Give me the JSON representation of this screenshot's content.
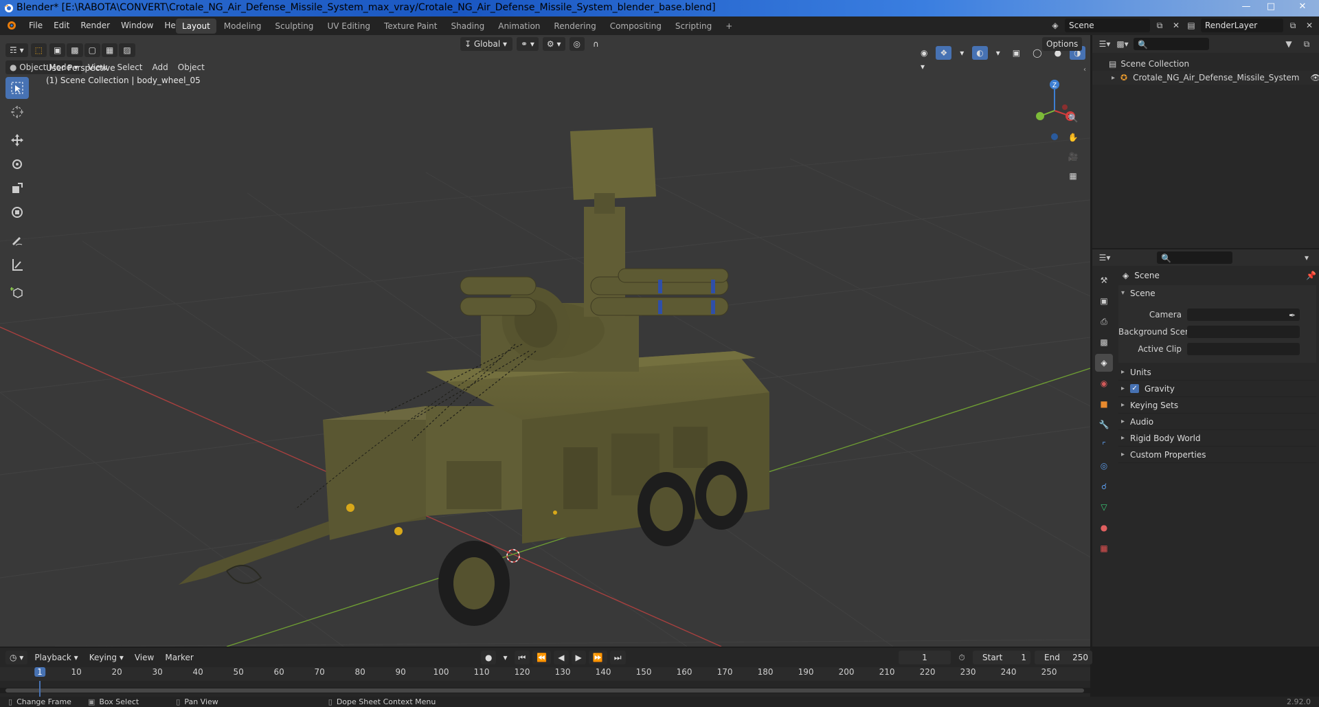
{
  "window": {
    "title": "Blender* [E:\\RABOTA\\CONVERT\\Crotale_NG_Air_Defense_Missile_System_max_vray/Crotale_NG_Air_Defense_Missile_System_blender_base.blend]",
    "controls": [
      "minimize-icon",
      "maximize-icon",
      "close-icon"
    ]
  },
  "topbar": {
    "menus": [
      "File",
      "Edit",
      "Render",
      "Window",
      "Help"
    ],
    "workspaces": [
      "Layout",
      "Modeling",
      "Sculpting",
      "UV Editing",
      "Texture Paint",
      "Shading",
      "Animation",
      "Rendering",
      "Compositing",
      "Scripting"
    ],
    "active_workspace": "Layout",
    "add_workspace": "+",
    "scene_name": "Scene",
    "view_layer": "RenderLayer"
  },
  "viewport": {
    "mode": "Object Mode",
    "menus": [
      "View",
      "Select",
      "Add",
      "Object"
    ],
    "orientation": "Global",
    "options_label": "Options",
    "overlay_line1": "User Perspective",
    "overlay_line2": "(1) Scene Collection | body_wheel_05",
    "gizmo_labels": {
      "z": "Z",
      "x": "X",
      "y": "Y"
    },
    "tools": [
      "select-box-icon",
      "cursor-icon",
      "move-icon",
      "rotate-icon",
      "scale-icon",
      "transform-icon",
      "annotate-icon",
      "measure-icon",
      "add-cube-icon"
    ],
    "nav": [
      "zoom-icon",
      "pan-hand-icon",
      "camera-view-icon",
      "grid-view-icon"
    ]
  },
  "outliner": {
    "root": "Scene Collection",
    "items": [
      {
        "label": "Crotale_NG_Air_Defense_Missile_System",
        "visible": true
      }
    ]
  },
  "properties": {
    "context": "Scene",
    "section_title": "Scene",
    "fields": [
      {
        "label": "Camera",
        "value": ""
      },
      {
        "label": "Background Scene",
        "value": ""
      },
      {
        "label": "Active Clip",
        "value": ""
      }
    ],
    "panels": [
      {
        "label": "Units",
        "checkbox": false
      },
      {
        "label": "Gravity",
        "checkbox": true,
        "checked": true
      },
      {
        "label": "Keying Sets",
        "checkbox": false
      },
      {
        "label": "Audio",
        "checkbox": false
      },
      {
        "label": "Rigid Body World",
        "checkbox": false
      },
      {
        "label": "Custom Properties",
        "checkbox": false
      }
    ],
    "tab_icons": [
      "tool-icon",
      "render-icon",
      "output-icon",
      "view-layer-icon",
      "scene-icon",
      "world-icon",
      "object-icon",
      "modifier-icon",
      "particles-icon",
      "physics-icon",
      "constraints-icon",
      "data-icon",
      "material-icon",
      "texture-icon"
    ]
  },
  "timeline": {
    "menus": [
      "Playback",
      "Keying",
      "View",
      "Marker"
    ],
    "current_frame": "1",
    "start_label": "Start",
    "start": "1",
    "end_label": "End",
    "end": "250",
    "ticks": [
      "1",
      "10",
      "20",
      "30",
      "40",
      "50",
      "60",
      "70",
      "80",
      "90",
      "100",
      "110",
      "120",
      "130",
      "140",
      "150",
      "160",
      "170",
      "180",
      "190",
      "200",
      "210",
      "220",
      "230",
      "240",
      "250"
    ]
  },
  "statusbar": {
    "items": [
      "Change Frame",
      "Box Select",
      "Pan View",
      "Dope Sheet Context Menu"
    ],
    "version": "2.92.0"
  },
  "colors": {
    "accent": "#4772b3",
    "x_axis": "#d33d3d",
    "y_axis": "#7dbb39",
    "z_axis": "#3d7fd3",
    "vehicle": "#5d5a33"
  }
}
